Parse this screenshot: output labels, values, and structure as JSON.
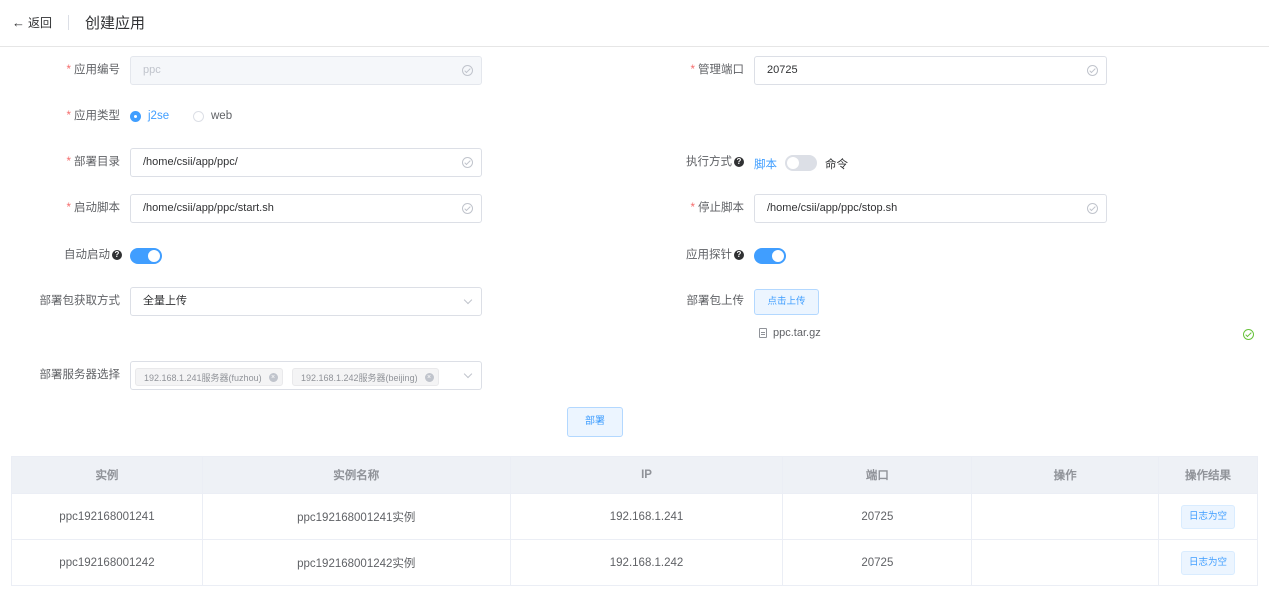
{
  "header": {
    "back_label": "返回",
    "title": "创建应用"
  },
  "form": {
    "app_code": {
      "label": "应用编号",
      "placeholder": "ppc"
    },
    "mgmt_port": {
      "label": "管理端口",
      "value": "20725"
    },
    "app_type": {
      "label": "应用类型",
      "options": [
        "j2se",
        "web"
      ],
      "selected": "j2se"
    },
    "deploy_dir": {
      "label": "部署目录",
      "value": "/home/csii/app/ppc/"
    },
    "exec_mode": {
      "label": "执行方式",
      "left_label": "脚本",
      "right_label": "命令",
      "on": false
    },
    "start_script": {
      "label": "启动脚本",
      "value": "/home/csii/app/ppc/start.sh"
    },
    "stop_script": {
      "label": "停止脚本",
      "value": "/home/csii/app/ppc/stop.sh"
    },
    "auto_start": {
      "label": "自动启动",
      "on": true
    },
    "app_probe": {
      "label": "应用探针",
      "on": true
    },
    "package_source": {
      "label": "部署包获取方式",
      "value": "全量上传"
    },
    "package_upload": {
      "label": "部署包上传",
      "button": "点击上传",
      "file_name": "ppc.tar.gz"
    },
    "servers": {
      "label": "部署服务器选择",
      "tags": [
        "192.168.1.241服务器(fuzhou)",
        "192.168.1.242服务器(beijing)"
      ]
    },
    "deploy_button": "部署"
  },
  "table": {
    "columns": [
      "实例",
      "实例名称",
      "IP",
      "端口",
      "操作",
      "操作结果"
    ],
    "rows": [
      {
        "instance": "ppc192168001241",
        "name": "ppc192168001241实例",
        "ip": "192.168.1.241",
        "port": "20725",
        "action": "",
        "result": "日志为空"
      },
      {
        "instance": "ppc192168001242",
        "name": "ppc192168001242实例",
        "ip": "192.168.1.242",
        "port": "20725",
        "action": "",
        "result": "日志为空"
      }
    ]
  },
  "colors": {
    "primary": "#409eff",
    "required": "#f56c6c",
    "success": "#67c23a"
  }
}
